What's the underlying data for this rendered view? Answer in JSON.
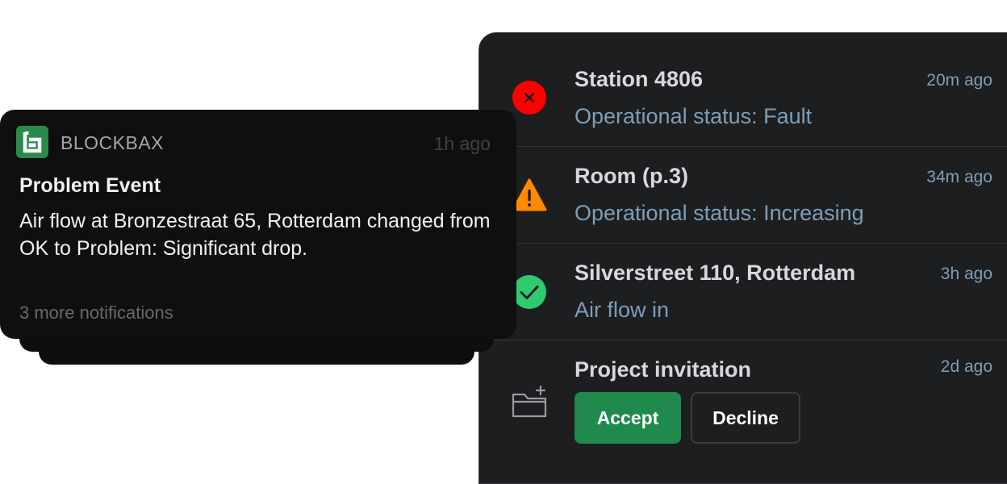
{
  "push_notification": {
    "app_name": "BLOCKBAX",
    "time": "1h ago",
    "title": "Problem Event",
    "body": "Air flow at Bronzestraat 65, Rotterdam changed from OK to Problem: Significant drop.",
    "more": "3 more notifications"
  },
  "notification_list": [
    {
      "icon": "error-icon",
      "title": "Station 4806",
      "subtitle": "Operational status: Fault",
      "time": "20m ago",
      "color": "#ff0000"
    },
    {
      "icon": "warning-icon",
      "title": "Room (p.3)",
      "subtitle": "Operational status: Increasing",
      "time": "34m ago",
      "color": "#ff8a00"
    },
    {
      "icon": "check-circle-icon",
      "title": "Silverstreet 110, Rotterdam",
      "subtitle": "Air flow in",
      "time": "3h ago",
      "color": "#2ecc71"
    },
    {
      "icon": "folder-add-icon",
      "title": "Project invitation",
      "time": "2d ago",
      "actions": {
        "accept": "Accept",
        "decline": "Decline"
      }
    }
  ],
  "colors": {
    "panel_bg": "#1d1e20",
    "toast_bg": "#0f0f10",
    "accent_green": "#1f8a4c",
    "brand_green": "#2a8a4c",
    "subtitle_blue": "#7f9db8"
  }
}
